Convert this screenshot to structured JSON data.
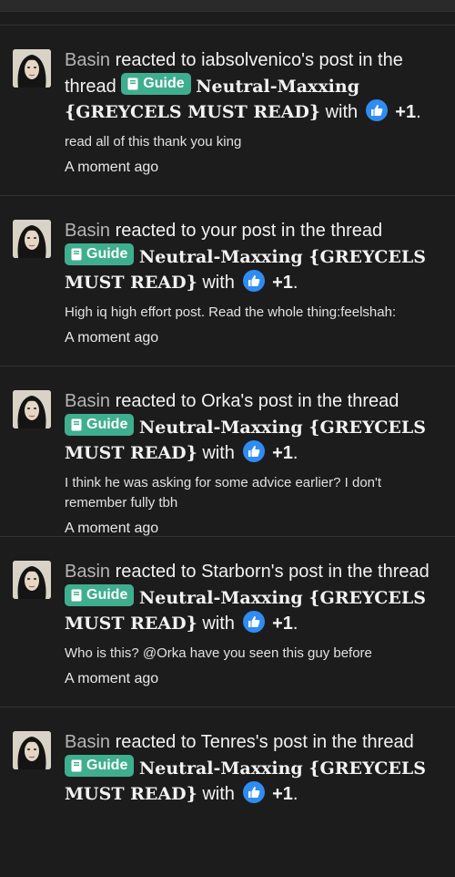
{
  "reactions": [
    {
      "user": "Basin",
      "action": "reacted to iabsolvenico's post in the thread",
      "badge": "Guide",
      "thread": "Neutral-Maxxing {GREYCELS MUST READ}",
      "with": "with",
      "reaction_count": "+1",
      "snippet": "read all of this thank you king",
      "time": "A moment ago"
    },
    {
      "user": "Basin",
      "action": "reacted to your post in the thread",
      "badge": "Guide",
      "thread": "Neutral-Maxxing {GREYCELS MUST READ}",
      "with": "with",
      "reaction_count": "+1",
      "snippet": "High iq high effort post. Read the whole thing:feelshah:",
      "time": "A moment ago"
    },
    {
      "user": "Basin",
      "action": "reacted to Orka's post in the thread",
      "badge": "Guide",
      "thread": "Neutral-Maxxing {GREYCELS MUST READ}",
      "with": "with",
      "reaction_count": "+1",
      "snippet": "I think he was asking for some advice earlier? I don't remember fully tbh",
      "time": "A moment ago"
    },
    {
      "user": "Basin",
      "action": "reacted to Starborn's post in the thread",
      "badge": "Guide",
      "thread": "Neutral-Maxxing {GREYCELS MUST READ}",
      "with": "with",
      "reaction_count": "+1",
      "snippet": "Who is this? @Orka have you seen this guy before",
      "time": "A moment ago"
    },
    {
      "user": "Basin",
      "action": "reacted to Tenres's post in the thread",
      "badge": "Guide",
      "thread": "Neutral-Maxxing {GREYCELS MUST READ}",
      "with": "with",
      "reaction_count": "+1",
      "snippet": "",
      "time": ""
    }
  ],
  "colors": {
    "background": "#1c1c1d",
    "badge": "#3fae8e",
    "like": "#2f8cf1",
    "username": "#b5b5b5"
  },
  "icons": {
    "badge_icon": "book-icon",
    "reaction_icon": "thumbs-up-icon",
    "avatar": "user-avatar"
  }
}
